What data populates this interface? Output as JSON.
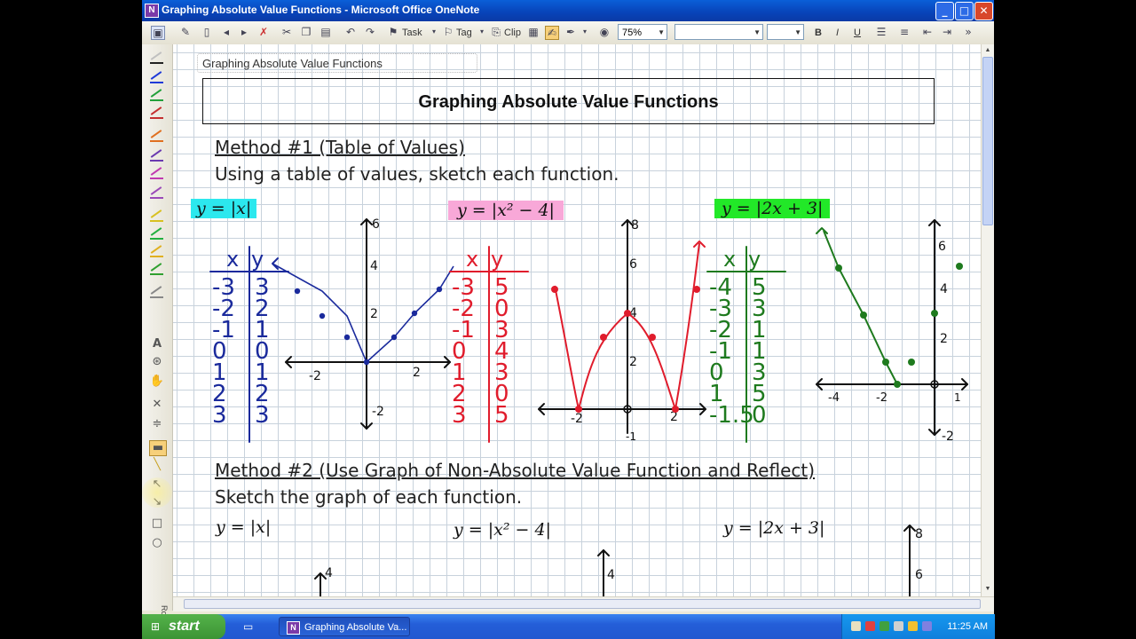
{
  "window": {
    "title": "Graphing Absolute Value Functions - Microsoft Office OneNote",
    "app_icon": "onenote-icon",
    "app_icon_letter": "N",
    "minimize_glyph": "_",
    "maximize_glyph": "□",
    "close_glyph": "✕"
  },
  "toolbar": {
    "task_label": "Task",
    "tag_label": "Tag",
    "clip_label": "Clip",
    "zoom": "75%",
    "font_name": "",
    "font_size": "",
    "bold": "B",
    "italic": "I",
    "underline": "U"
  },
  "left_tools": {
    "text_tool": "A",
    "rotate_label": "Rotate",
    "pen_colors": [
      "#c0c0c0",
      "#1f3ad8",
      "#22a03a",
      "#c43030",
      "#e07020",
      "#6a3ab0",
      "#c03ab0",
      "#9a4ab8",
      "#d8c020",
      "#22b040",
      "#e0b020",
      "#30a030",
      "#888888"
    ]
  },
  "page": {
    "title": "Graphing Absolute Value Functions",
    "header": "Graphing Absolute Value Functions",
    "method1_title": "Method #1 (Table of Values)",
    "method1_instruction": "Using a table of values, sketch each function.",
    "method2_title": "Method #2 (Use Graph of Non-Absolute Value Function and Reflect)",
    "method2_instruction": "Sketch the graph of each function.",
    "functions": {
      "f1": "y = |x|",
      "f2": "y = |x² − 4|",
      "f3": "y = |2x + 3|"
    }
  },
  "handwriting": {
    "table_header_x": "x",
    "table_header_y": "y",
    "table1": {
      "x": [
        "-3",
        "-2",
        "-1",
        "0",
        "1",
        "2",
        "3"
      ],
      "y": [
        "3",
        "2",
        "1",
        "0",
        "1",
        "2",
        "3"
      ]
    },
    "table2": {
      "x": [
        "-3",
        "-2",
        "-1",
        "0",
        "1",
        "2",
        "3"
      ],
      "y": [
        "5",
        "0",
        "3",
        "4",
        "3",
        "0",
        "5"
      ]
    },
    "table3": {
      "x": [
        "-4",
        "-3",
        "-2",
        "-1",
        "0",
        "1",
        "-1.5"
      ],
      "y": [
        "5",
        "3",
        "1",
        "1",
        "3",
        "5",
        "0"
      ]
    },
    "graph1_ticks": {
      "y_top": "6",
      "y_4": "4",
      "y_2": "2",
      "y_neg": "-2",
      "x_neg": "-2",
      "x_pos": "2"
    },
    "graph2_ticks": {
      "y_top": "8",
      "y_6": "6",
      "y_4": "4",
      "y_2": "2",
      "y_neg": "-1",
      "x_neg": "-2",
      "x_pos": "2"
    },
    "graph3_ticks": {
      "y_6": "6",
      "y_4": "4",
      "y_2": "2",
      "y_neg": "-2",
      "x_neg4": "-4",
      "x_neg2": "-2",
      "x_pos": "1"
    },
    "method2_ticks": {
      "g1": "4",
      "g2": "4",
      "g3_8": "8",
      "g3_6": "6"
    }
  },
  "colors": {
    "ink_blue": "#1a2a9c",
    "ink_red": "#e01c2c",
    "ink_green": "#1e7a1e",
    "ink_black": "#111111",
    "highlight_cyan": "#2ce8ee",
    "highlight_pink": "#f8a8d8",
    "highlight_green": "#22e828"
  },
  "taskbar": {
    "start_label": "start",
    "task_window": "Graphing Absolute Va...",
    "clock": "11:25 AM"
  }
}
